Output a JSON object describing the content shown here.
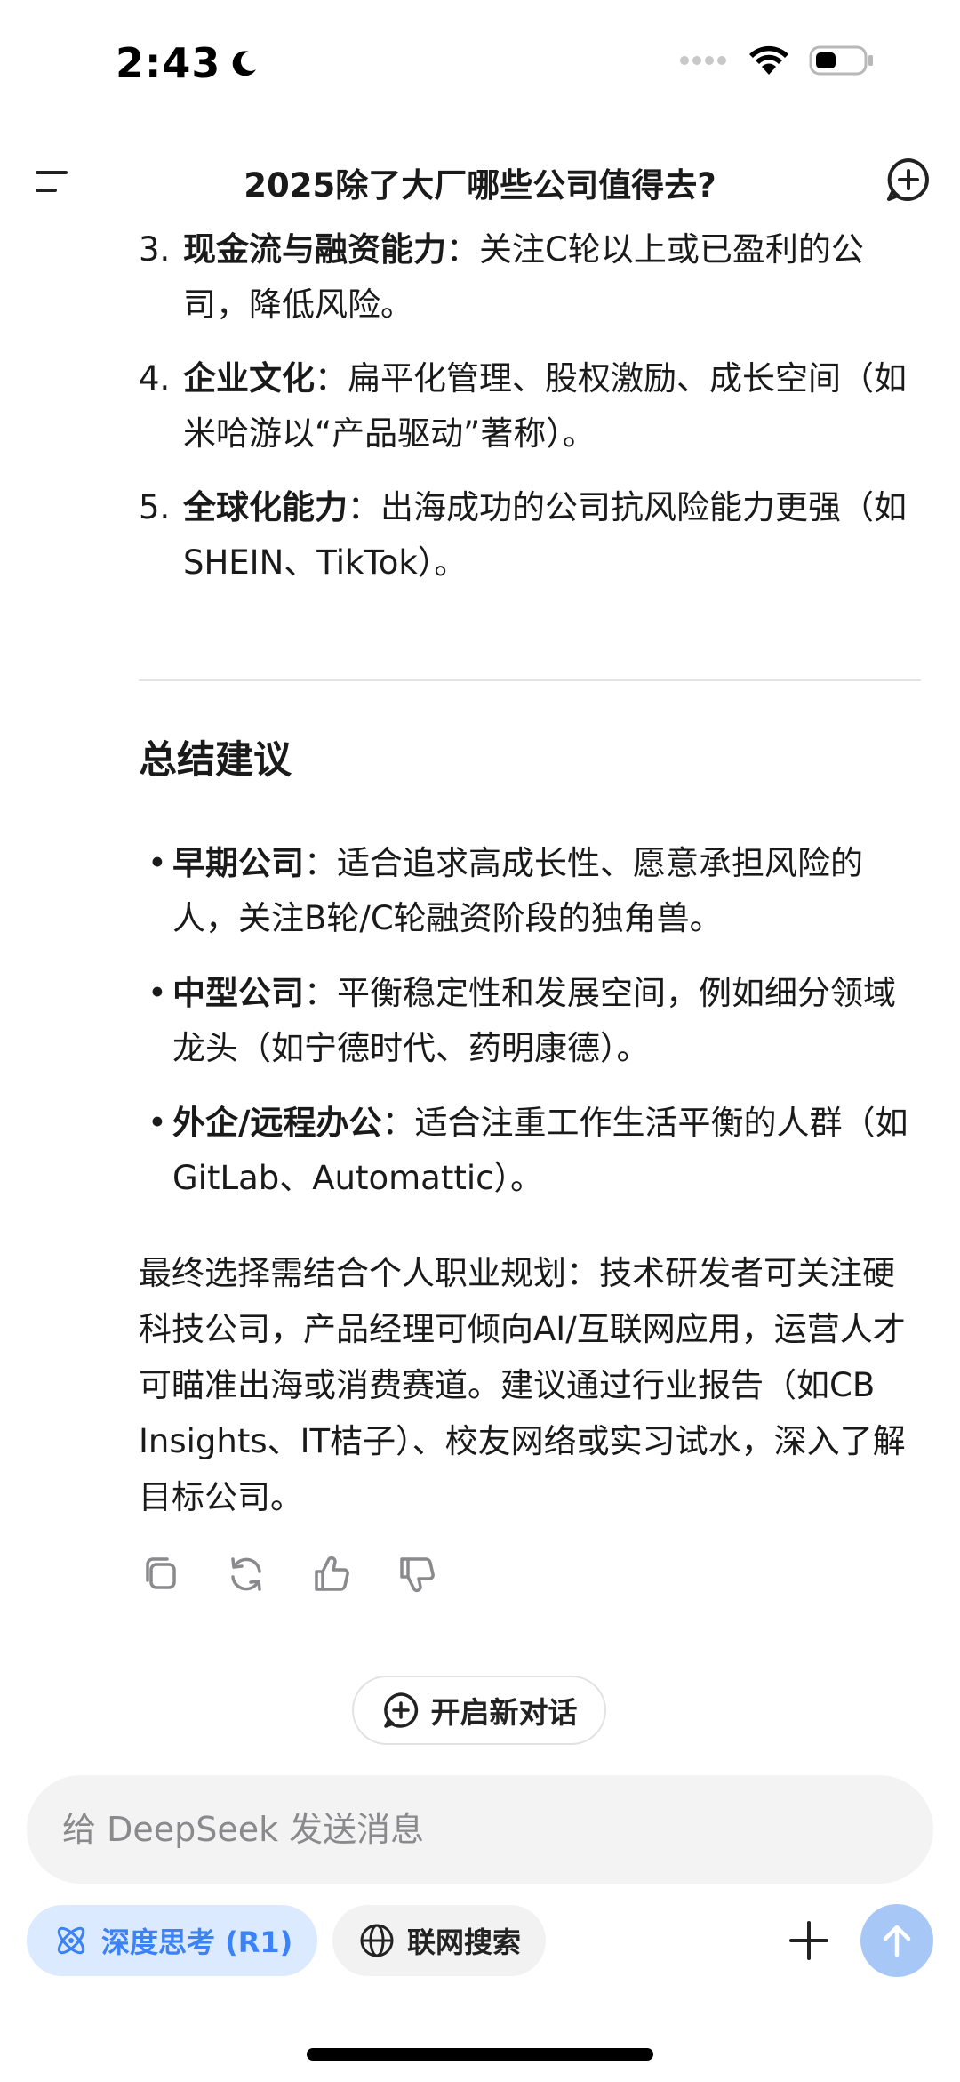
{
  "status": {
    "time": "2:43"
  },
  "header": {
    "title": "2025除了大厂哪些公司值得去?"
  },
  "numbered_list": [
    {
      "num": "3.",
      "label": "现金流与融资能力",
      "text": "：关注C轮以上或已盈利的公司，降低风险。"
    },
    {
      "num": "4.",
      "label": "企业文化",
      "text": "：扁平化管理、股权激励、成长空间（如米哈游以“产品驱动”著称）。"
    },
    {
      "num": "5.",
      "label": "全球化能力",
      "text": "：出海成功的公司抗风险能力更强（如SHEIN、TikTok）。"
    }
  ],
  "summary": {
    "title": "总结建议",
    "bullets": [
      {
        "label": "早期公司",
        "text": "：适合追求高成长性、愿意承担风险的人，关注B轮/C轮融资阶段的独角兽。"
      },
      {
        "label": "中型公司",
        "text": "：平衡稳定性和发展空间，例如细分领域龙头（如宁德时代、药明康德）。"
      },
      {
        "label": "外企/远程办公",
        "text": "：适合注重工作生活平衡的人群（如GitLab、Automattic）。"
      }
    ],
    "final": "最终选择需结合个人职业规划：技术研发者可关注硬科技公司，产品经理可倾向AI/互联网应用，运营人才可瞄准出海或消费赛道。建议通过行业报告（如CB Insights、IT桔子）、校友网络或实习试水，深入了解目标公司。"
  },
  "new_conversation_label": "开启新对话",
  "input": {
    "placeholder": "给 DeepSeek 发送消息"
  },
  "chips": {
    "deep_think": "深度思考 (R1)",
    "web_search": "联网搜索"
  },
  "colors": {
    "accent": "#3b82f6",
    "send_bg": "#a7c8f7"
  }
}
